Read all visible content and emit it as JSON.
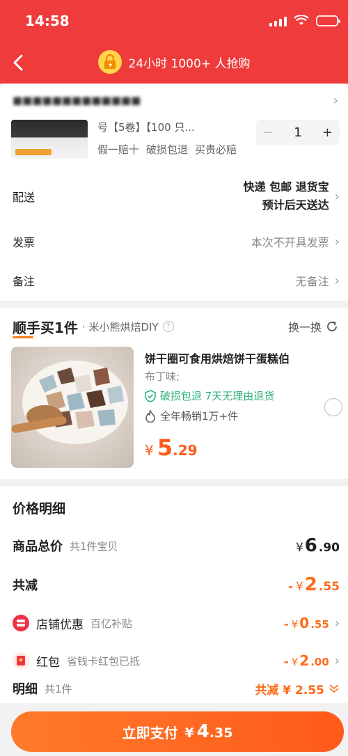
{
  "status_bar": {
    "time": "14:58"
  },
  "nav": {
    "title": "24小时 1000+ 人抢购"
  },
  "order": {
    "shop_name": "■■■■■■■■■■■■■",
    "product_name": "号【5卷】【100 只...",
    "tags": [
      "假一赔十",
      "破损包退",
      "买贵必赔"
    ],
    "quantity": "1",
    "minus": "−",
    "plus": "+",
    "delivery": {
      "label": "配送",
      "line1": "快递 包邮 退货宝",
      "line2": "预计后天送达"
    },
    "invoice": {
      "label": "发票",
      "value": "本次不开具发票"
    },
    "remark": {
      "label": "备注",
      "value": "无备注"
    }
  },
  "combo": {
    "title": "顺手买1件",
    "shop": "· 米小熊烘焙DIY",
    "swap_label": "换一换",
    "product_name": "饼干圈可食用烘焙饼干蛋糕伯",
    "product_sub": "布丁味;",
    "guarantee": "破损包退  7天无理由退货",
    "sales": "全年畅销1万+件",
    "price_yen": "¥",
    "price_int": "5",
    "price_dec": ".29"
  },
  "price": {
    "title": "价格明细",
    "total": {
      "label": "商品总价",
      "sub": "共1件宝贝",
      "yen": "¥",
      "int": "6",
      "dec": ".90"
    },
    "reduce": {
      "label": "共减",
      "sign": "-",
      "yen": "¥",
      "int": "2",
      "dec": ".55"
    },
    "shop_coupon": {
      "label": "店铺优惠",
      "sub": "百亿补贴",
      "sign": "-",
      "yen": "¥",
      "int": "0",
      "dec": ".55"
    },
    "red_packet": {
      "label": "红包",
      "sub": "省钱卡红包已抵",
      "sign": "-",
      "yen": "¥",
      "int": "2",
      "dec": ".00"
    },
    "detail": {
      "label": "明细",
      "sub": "共1件",
      "total": "共减 ¥ 2.55"
    }
  },
  "pay": {
    "label": "立即支付",
    "yen": "¥",
    "int": "4",
    "dec": ".35"
  },
  "colors": {
    "header": "#ef3b3b",
    "accent": "#ff5a1a",
    "green": "#2bb07a"
  },
  "icons": [
    "back-arrow-icon",
    "lock-icon",
    "wifi-icon",
    "battery-icon",
    "chevron-right-icon",
    "refresh-icon",
    "shield-check-icon",
    "flame-icon",
    "coupon-icon",
    "red-packet-icon",
    "chevron-down-double-icon"
  ]
}
